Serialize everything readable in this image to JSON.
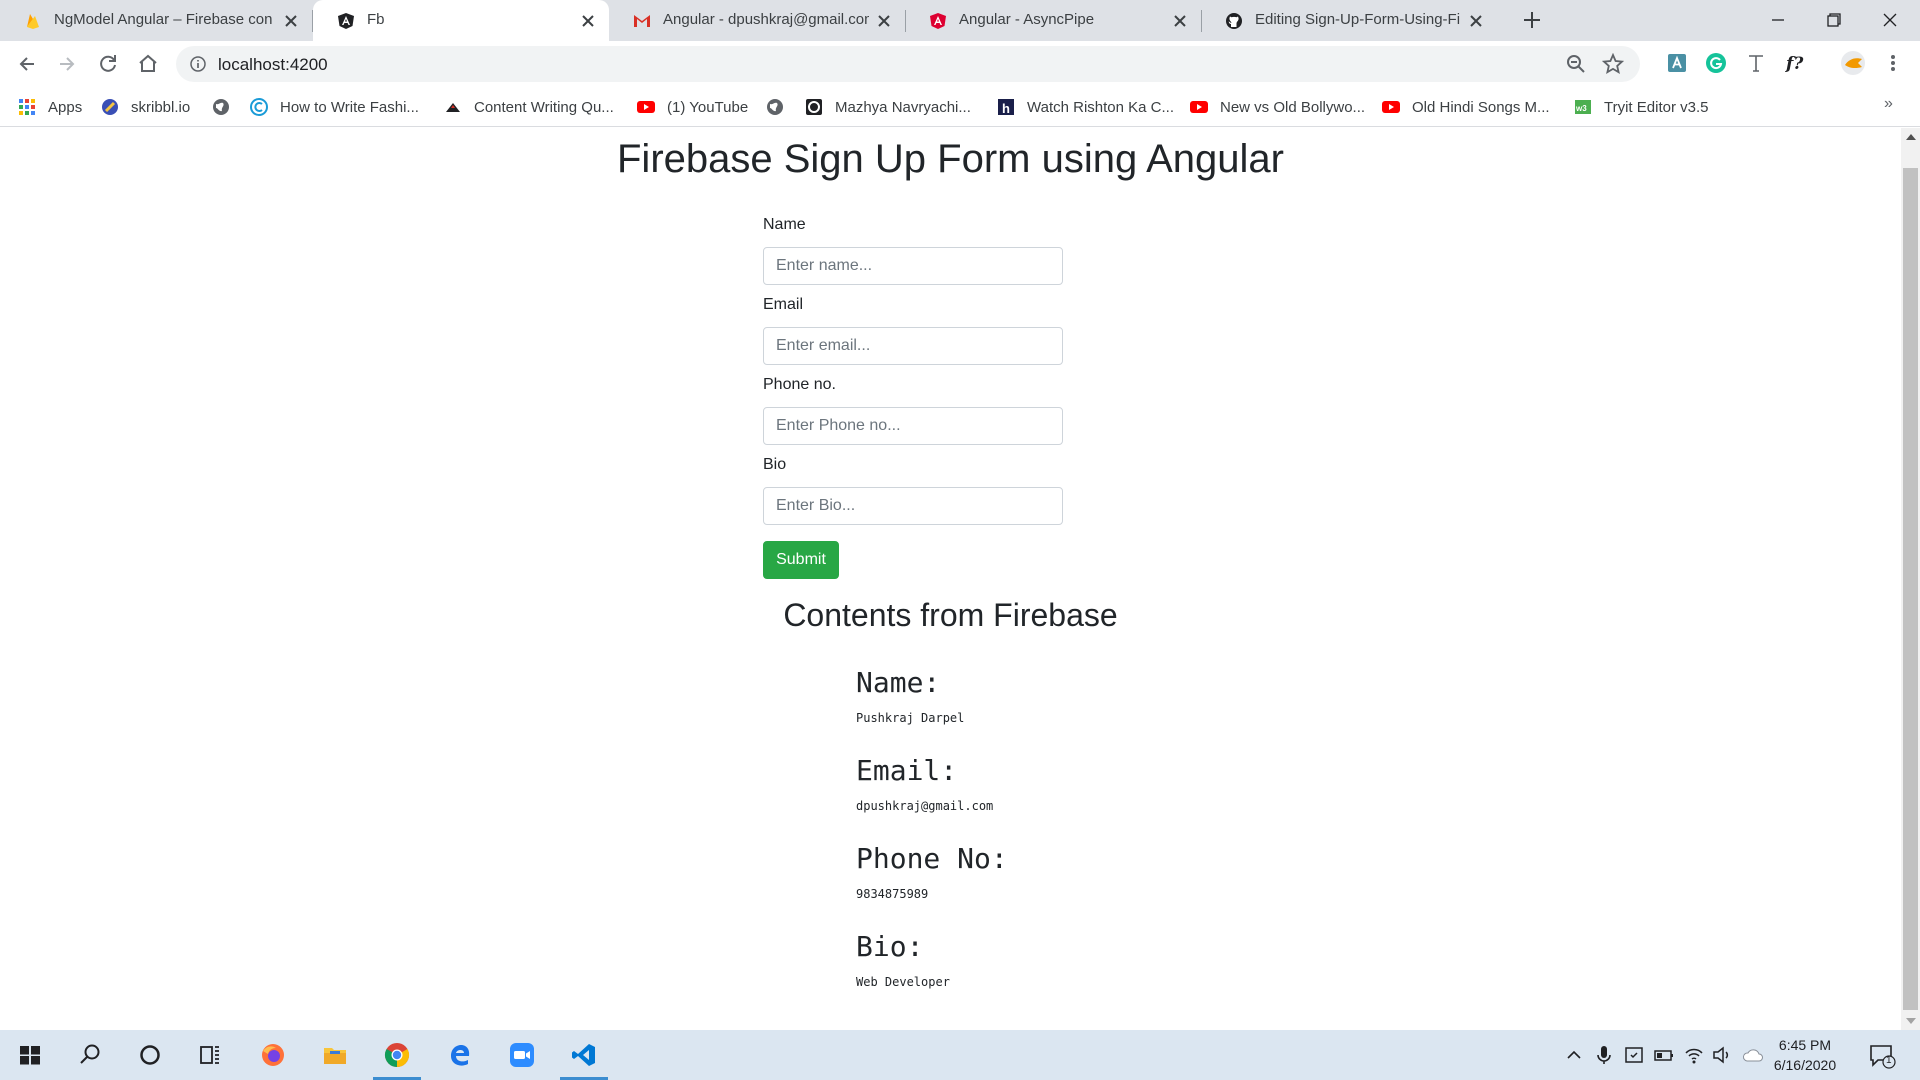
{
  "browser": {
    "tabs": [
      {
        "title": "NgModel Angular – Firebase con",
        "icon": "firebase-icon",
        "active": false
      },
      {
        "title": "Fb",
        "icon": "angular-icon",
        "active": true
      },
      {
        "title": "Angular - dpushkraj@gmail.com",
        "icon": "gmail-icon",
        "active": false
      },
      {
        "title": "Angular - AsyncPipe",
        "icon": "angular-icon",
        "active": false
      },
      {
        "title": "Editing Sign-Up-Form-Using-Fire",
        "icon": "github-icon",
        "active": false
      }
    ],
    "address": "localhost:4200",
    "bookmarks": [
      {
        "label": "Apps",
        "icon": "apps-grid-icon"
      },
      {
        "label": "skribbl.io",
        "icon": "skribbl-icon"
      },
      {
        "label": "",
        "icon": "globe-icon"
      },
      {
        "label": "How to Write Fashi...",
        "icon": "link-icon"
      },
      {
        "label": "Content Writing Qu...",
        "icon": "content-icon"
      },
      {
        "label": "(1) YouTube",
        "icon": "youtube-icon"
      },
      {
        "label": "",
        "icon": "globe-icon"
      },
      {
        "label": "Mazhya Navryachi...",
        "icon": "video-icon"
      },
      {
        "label": "Watch Rishton Ka C...",
        "icon": "hotstar-icon"
      },
      {
        "label": "New vs Old Bollywo...",
        "icon": "youtube-icon"
      },
      {
        "label": "Old Hindi Songs M...",
        "icon": "youtube-icon"
      },
      {
        "label": "Tryit Editor v3.5",
        "icon": "w3schools-icon"
      }
    ]
  },
  "page": {
    "title": "Firebase Sign Up Form using Angular",
    "form": {
      "fields": [
        {
          "label": "Name",
          "placeholder": "Enter name...",
          "value": ""
        },
        {
          "label": "Email",
          "placeholder": "Enter email...",
          "value": ""
        },
        {
          "label": "Phone no.",
          "placeholder": "Enter Phone no...",
          "value": ""
        },
        {
          "label": "Bio",
          "placeholder": "Enter Bio...",
          "value": ""
        }
      ],
      "submit_label": "Submit"
    },
    "contents_heading": "Contents from Firebase",
    "record": [
      {
        "label": "Name:",
        "value": "Pushkraj Darpel"
      },
      {
        "label": "Email:",
        "value": "dpushkraj@gmail.com"
      },
      {
        "label": "Phone No:",
        "value": "9834875989"
      },
      {
        "label": "Bio:",
        "value": "Web Developer"
      }
    ]
  },
  "taskbar": {
    "time": "6:45 PM",
    "date": "6/16/2020",
    "notification_count": "1",
    "apps": [
      "windows-start-icon",
      "search-icon",
      "cortana-icon",
      "task-view-icon",
      "firefox-icon",
      "file-explorer-icon",
      "chrome-icon",
      "edge-icon",
      "zoom-icon",
      "vscode-icon"
    ]
  },
  "colors": {
    "submit": "#28a745",
    "tab_strip": "#dee1e6",
    "taskbar": "#dbe6f1"
  }
}
